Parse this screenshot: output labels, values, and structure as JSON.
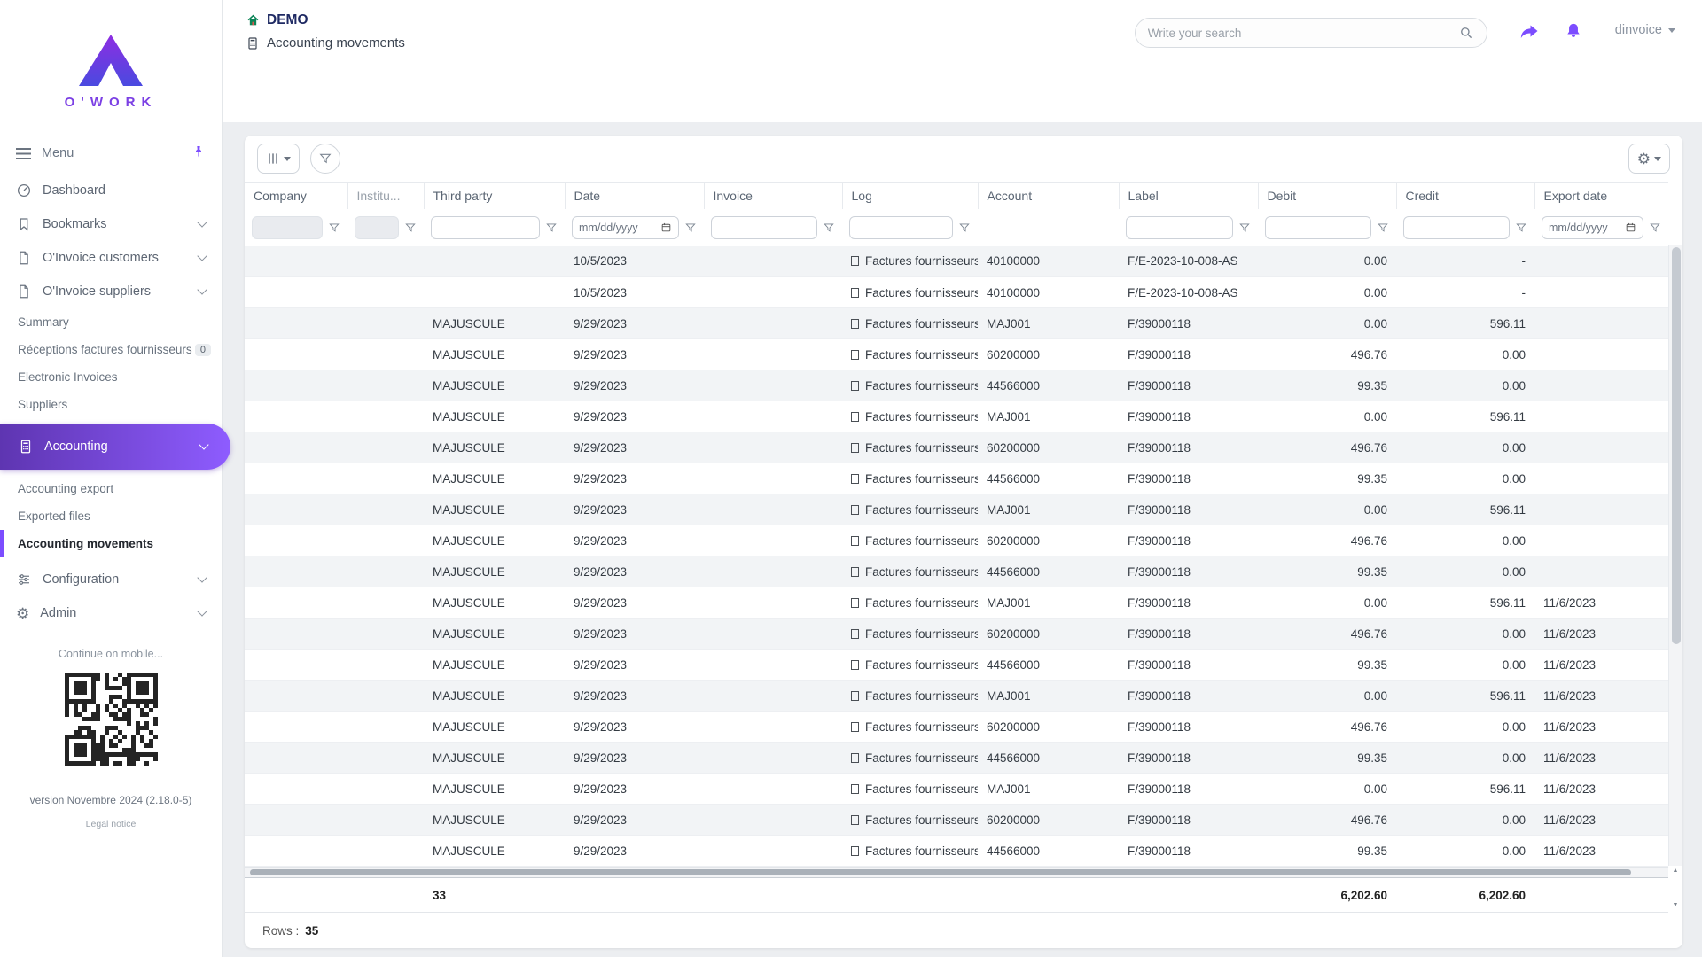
{
  "theme": {
    "accent": "#7c4dff",
    "grad-from": "#5e35b1",
    "grad-to": "#8e5cff",
    "navy": "#1f2a63"
  },
  "sidebar": {
    "logo_text": "O'WORK",
    "menu_label": "Menu",
    "items_top": [
      {
        "label": "Dashboard"
      },
      {
        "label": "Bookmarks"
      },
      {
        "label": "O'Invoice customers"
      },
      {
        "label": "O'Invoice suppliers"
      }
    ],
    "supplier_links": [
      {
        "label": "Summary"
      },
      {
        "label": "Réceptions factures fournisseurs",
        "badge": "0"
      },
      {
        "label": "Electronic Invoices"
      },
      {
        "label": "Suppliers"
      }
    ],
    "accounting_label": "Accounting",
    "accounting_links": [
      {
        "label": "Accounting export"
      },
      {
        "label": "Exported files"
      },
      {
        "label": "Accounting movements"
      }
    ],
    "items_bottom": [
      {
        "label": "Configuration"
      },
      {
        "label": "Admin"
      }
    ],
    "mobile_hint": "Continue on mobile...",
    "version": "version Novembre 2024 (2.18.0-5)",
    "legal_notice": "Legal notice"
  },
  "header": {
    "badge": "DEMO",
    "title": "Accounting movements",
    "search_placeholder": "Write your search",
    "username": "dinvoice"
  },
  "grid": {
    "columns": [
      "Company",
      "Institu...",
      "Third party",
      "Date",
      "Invoice",
      "Log",
      "Account",
      "Label",
      "Debit",
      "Credit",
      "Export date"
    ],
    "date_placeholder": "mm/dd/yyyy",
    "rows": [
      {
        "company": "",
        "institution": "",
        "third_party": "",
        "date": "10/5/2023",
        "invoice": "",
        "log": "Factures fournisseurs",
        "account": "40100000",
        "label": "F/E-2023-10-008-AS",
        "debit": "0.00",
        "credit": "-",
        "export_date": ""
      },
      {
        "company": "",
        "institution": "",
        "third_party": "",
        "date": "10/5/2023",
        "invoice": "",
        "log": "Factures fournisseurs",
        "account": "40100000",
        "label": "F/E-2023-10-008-AS",
        "debit": "0.00",
        "credit": "-",
        "export_date": ""
      },
      {
        "company": "",
        "institution": "",
        "third_party": "MAJUSCULE",
        "date": "9/29/2023",
        "invoice": "",
        "log": "Factures fournisseurs",
        "account": "MAJ001",
        "label": "F/39000118",
        "debit": "0.00",
        "credit": "596.11",
        "export_date": ""
      },
      {
        "company": "",
        "institution": "",
        "third_party": "MAJUSCULE",
        "date": "9/29/2023",
        "invoice": "",
        "log": "Factures fournisseurs",
        "account": "60200000",
        "label": "F/39000118",
        "debit": "496.76",
        "credit": "0.00",
        "export_date": ""
      },
      {
        "company": "",
        "institution": "",
        "third_party": "MAJUSCULE",
        "date": "9/29/2023",
        "invoice": "",
        "log": "Factures fournisseurs",
        "account": "44566000",
        "label": "F/39000118",
        "debit": "99.35",
        "credit": "0.00",
        "export_date": ""
      },
      {
        "company": "",
        "institution": "",
        "third_party": "MAJUSCULE",
        "date": "9/29/2023",
        "invoice": "",
        "log": "Factures fournisseurs",
        "account": "MAJ001",
        "label": "F/39000118",
        "debit": "0.00",
        "credit": "596.11",
        "export_date": ""
      },
      {
        "company": "",
        "institution": "",
        "third_party": "MAJUSCULE",
        "date": "9/29/2023",
        "invoice": "",
        "log": "Factures fournisseurs",
        "account": "60200000",
        "label": "F/39000118",
        "debit": "496.76",
        "credit": "0.00",
        "export_date": ""
      },
      {
        "company": "",
        "institution": "",
        "third_party": "MAJUSCULE",
        "date": "9/29/2023",
        "invoice": "",
        "log": "Factures fournisseurs",
        "account": "44566000",
        "label": "F/39000118",
        "debit": "99.35",
        "credit": "0.00",
        "export_date": ""
      },
      {
        "company": "",
        "institution": "",
        "third_party": "MAJUSCULE",
        "date": "9/29/2023",
        "invoice": "",
        "log": "Factures fournisseurs",
        "account": "MAJ001",
        "label": "F/39000118",
        "debit": "0.00",
        "credit": "596.11",
        "export_date": ""
      },
      {
        "company": "",
        "institution": "",
        "third_party": "MAJUSCULE",
        "date": "9/29/2023",
        "invoice": "",
        "log": "Factures fournisseurs",
        "account": "60200000",
        "label": "F/39000118",
        "debit": "496.76",
        "credit": "0.00",
        "export_date": ""
      },
      {
        "company": "",
        "institution": "",
        "third_party": "MAJUSCULE",
        "date": "9/29/2023",
        "invoice": "",
        "log": "Factures fournisseurs",
        "account": "44566000",
        "label": "F/39000118",
        "debit": "99.35",
        "credit": "0.00",
        "export_date": ""
      },
      {
        "company": "",
        "institution": "",
        "third_party": "MAJUSCULE",
        "date": "9/29/2023",
        "invoice": "",
        "log": "Factures fournisseurs",
        "account": "MAJ001",
        "label": "F/39000118",
        "debit": "0.00",
        "credit": "596.11",
        "export_date": "11/6/2023"
      },
      {
        "company": "",
        "institution": "",
        "third_party": "MAJUSCULE",
        "date": "9/29/2023",
        "invoice": "",
        "log": "Factures fournisseurs",
        "account": "60200000",
        "label": "F/39000118",
        "debit": "496.76",
        "credit": "0.00",
        "export_date": "11/6/2023"
      },
      {
        "company": "",
        "institution": "",
        "third_party": "MAJUSCULE",
        "date": "9/29/2023",
        "invoice": "",
        "log": "Factures fournisseurs",
        "account": "44566000",
        "label": "F/39000118",
        "debit": "99.35",
        "credit": "0.00",
        "export_date": "11/6/2023"
      },
      {
        "company": "",
        "institution": "",
        "third_party": "MAJUSCULE",
        "date": "9/29/2023",
        "invoice": "",
        "log": "Factures fournisseurs",
        "account": "MAJ001",
        "label": "F/39000118",
        "debit": "0.00",
        "credit": "596.11",
        "export_date": "11/6/2023"
      },
      {
        "company": "",
        "institution": "",
        "third_party": "MAJUSCULE",
        "date": "9/29/2023",
        "invoice": "",
        "log": "Factures fournisseurs",
        "account": "60200000",
        "label": "F/39000118",
        "debit": "496.76",
        "credit": "0.00",
        "export_date": "11/6/2023"
      },
      {
        "company": "",
        "institution": "",
        "third_party": "MAJUSCULE",
        "date": "9/29/2023",
        "invoice": "",
        "log": "Factures fournisseurs",
        "account": "44566000",
        "label": "F/39000118",
        "debit": "99.35",
        "credit": "0.00",
        "export_date": "11/6/2023"
      },
      {
        "company": "",
        "institution": "",
        "third_party": "MAJUSCULE",
        "date": "9/29/2023",
        "invoice": "",
        "log": "Factures fournisseurs",
        "account": "MAJ001",
        "label": "F/39000118",
        "debit": "0.00",
        "credit": "596.11",
        "export_date": "11/6/2023"
      },
      {
        "company": "",
        "institution": "",
        "third_party": "MAJUSCULE",
        "date": "9/29/2023",
        "invoice": "",
        "log": "Factures fournisseurs",
        "account": "60200000",
        "label": "F/39000118",
        "debit": "496.76",
        "credit": "0.00",
        "export_date": "11/6/2023"
      },
      {
        "company": "",
        "institution": "",
        "third_party": "MAJUSCULE",
        "date": "9/29/2023",
        "invoice": "",
        "log": "Factures fournisseurs",
        "account": "44566000",
        "label": "F/39000118",
        "debit": "99.35",
        "credit": "0.00",
        "export_date": "11/6/2023"
      }
    ],
    "totals": {
      "third_party": "33",
      "debit": "6,202.60",
      "credit": "6,202.60"
    },
    "rows_label": "Rows :",
    "rows_count": "35"
  }
}
